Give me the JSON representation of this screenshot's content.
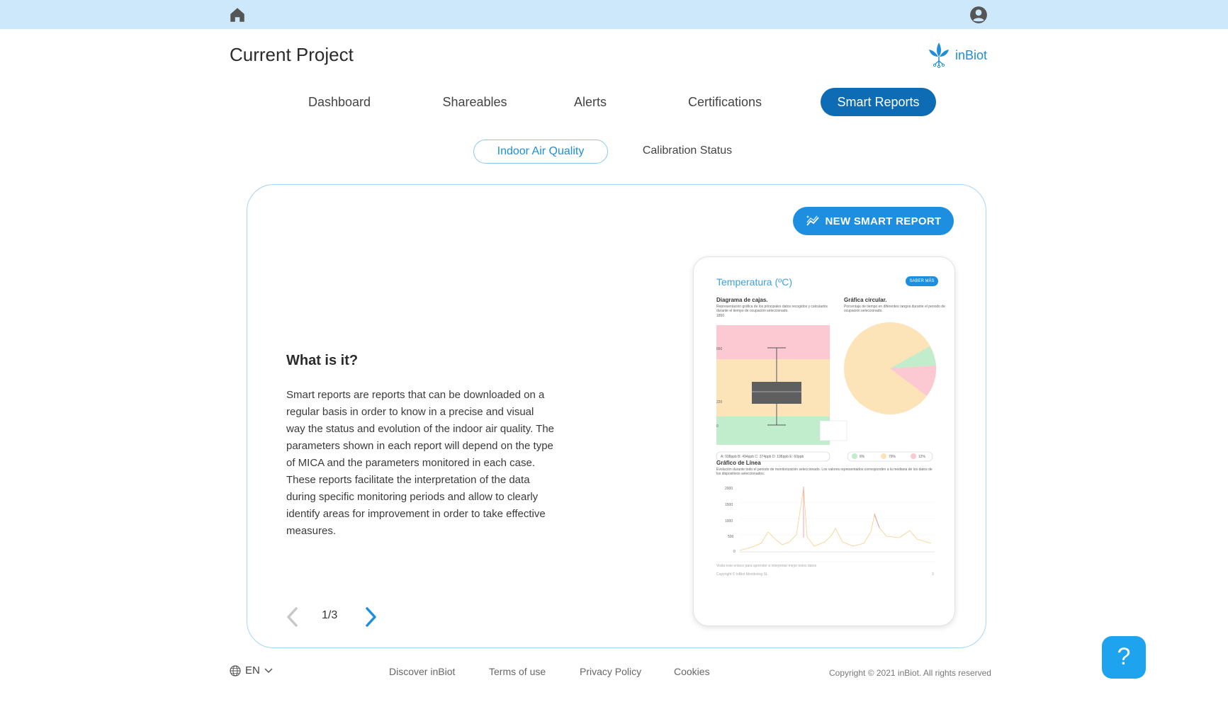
{
  "header": {
    "home_icon": "home-icon",
    "user_icon": "account-circle-icon"
  },
  "project": {
    "title": "Current Project"
  },
  "brand": {
    "name": "inBiot",
    "color": "#1e8fd6"
  },
  "tabs": [
    {
      "label": "Dashboard",
      "active": false
    },
    {
      "label": "Shareables",
      "active": false
    },
    {
      "label": "Alerts",
      "active": false
    },
    {
      "label": "Certifications",
      "active": false
    },
    {
      "label": "Smart Reports",
      "active": true
    }
  ],
  "subtabs": [
    {
      "label": "Indoor Air Quality",
      "active": true
    },
    {
      "label": "Calibration Status",
      "active": false
    }
  ],
  "card": {
    "new_button_label": "NEW SMART REPORT",
    "heading": "What is it?",
    "body": "Smart reports are reports that can be downloaded on a regular basis in order to know in a precise and visual way the status and evolution of the indoor air quality. The parameters shown in each report will depend on the type of MICA and the parameters monitored in each case. These reports facilitate the interpretation of the data during specific monitoring periods and allow to clearly identify areas for improvement in order to take effective measures.",
    "pager": "1/3"
  },
  "preview": {
    "title": "Temperatura (ºC)",
    "saber_mas": "SABER MÁS",
    "box_title": "Diagrama de cajas.",
    "box_desc": "Representación gráfica de los principales datos recogidos y calculados durante el tiempo de ocupación seleccionado.",
    "pie_title": "Gráfica circular.",
    "pie_desc": "Porcentaje de tiempo en diferentes rangos durante el periodo de ocupación seleccionado.",
    "box_ticks": [
      "1850",
      "660",
      "220",
      "0"
    ],
    "box_stats": "A: 938ppb  B: 494ppb  C: 374ppb  D: 198ppb  E: 60ppb",
    "pie_legend": [
      "8%",
      "79%",
      "12%"
    ],
    "line_title": "Gráfico de Línea",
    "line_desc": "Evolución durante todo el periodo de monitorización seleccionado. Los valores representados corresponden a la mediana de los datos de los dispositivos seleccionados.",
    "line_ticks": [
      "2000",
      "1500",
      "1000",
      "500",
      "0"
    ],
    "visit_text": "Visita este enlace para aprender a interpretar mejor estos datos",
    "copyright": "Copyright © inBiot Monitoring SL",
    "page_num": "3"
  },
  "footer": {
    "language": "EN",
    "links": [
      "Discover inBiot",
      "Terms of use",
      "Privacy Policy",
      "Cookies"
    ],
    "copyright": "Copyright © 2021 inBiot. All rights reserved"
  },
  "help": {
    "label": "?"
  },
  "colors": {
    "topbar": "#cce8fa",
    "primary": "#0e6cb5",
    "accent": "#1e8fe0"
  }
}
